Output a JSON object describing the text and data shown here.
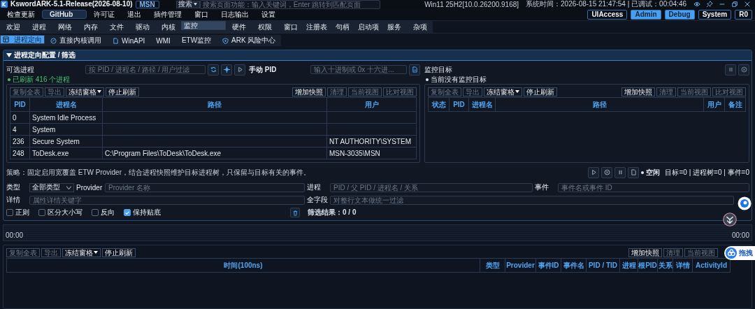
{
  "window": {
    "title": "KswordARK-5.1-Release(2026-08-10)",
    "user_badge": "MSN"
  },
  "search": {
    "scope": "搜索",
    "placeholder": "搜索页面功能：输入关键词，Enter 跳转到匹配页面"
  },
  "system_info": {
    "version": "Win11 25H2[10.0.26200.9168]",
    "clock": "系统时间：2026-08-15 21:47:54 | 已调试：00:04:46"
  },
  "menu": [
    {
      "label": "检查更新",
      "selected": false
    },
    {
      "label": "GitHub",
      "selected": true
    },
    {
      "label": "许可证",
      "selected": false
    },
    {
      "label": "退出",
      "selected": false
    },
    {
      "label": "插件管理",
      "selected": false
    },
    {
      "label": "窗口",
      "selected": false
    },
    {
      "label": "日志输出",
      "selected": false
    },
    {
      "label": "设置",
      "selected": false
    }
  ],
  "badges": [
    {
      "label": "UIAccess",
      "on": false
    },
    {
      "label": "Admin",
      "on": true
    },
    {
      "label": "Debug",
      "on": true
    },
    {
      "label": "System",
      "on": false
    },
    {
      "label": "R0",
      "on": false
    }
  ],
  "tabs": [
    {
      "label": "欢迎",
      "selected": false
    },
    {
      "label": "进程",
      "selected": false
    },
    {
      "label": "网络",
      "selected": false
    },
    {
      "label": "内存",
      "selected": false
    },
    {
      "label": "文件",
      "selected": false
    },
    {
      "label": "驱动",
      "selected": false
    },
    {
      "label": "内核",
      "selected": false
    },
    {
      "label": "监控",
      "selected": true
    },
    {
      "label": "硬件",
      "selected": false
    },
    {
      "label": "权限",
      "selected": false
    },
    {
      "label": "窗口",
      "selected": false
    },
    {
      "label": "注册表",
      "selected": false
    },
    {
      "label": "句柄",
      "selected": false
    },
    {
      "label": "启动项",
      "selected": false
    },
    {
      "label": "服务",
      "selected": false
    },
    {
      "label": "杂项",
      "selected": false
    }
  ],
  "subtabs": [
    {
      "label": "进程定向",
      "selected": true
    },
    {
      "label": "直接内核调用",
      "selected": false
    },
    {
      "label": "WinAPI",
      "selected": false
    },
    {
      "label": "WMI",
      "selected": false
    },
    {
      "label": "ETW监控",
      "selected": false
    },
    {
      "label": "ARK 风险中心",
      "selected": false
    }
  ],
  "panel": {
    "title": "进程定向配置 / 筛选",
    "expanded": true,
    "picker": {
      "label": "可选进程",
      "filter_placeholder": "按 PID / 进程名 / 路径 / 用户过滤",
      "manual_label": "手动 PID",
      "manual_placeholder": "输入十进制或 0x 十六进...",
      "status": "已刷新 416 个进程",
      "table": {
        "toolbar_left": [
          {
            "label": "复制全表",
            "disabled": true,
            "dropdown": false
          },
          {
            "label": "导出",
            "disabled": true,
            "dropdown": false
          },
          {
            "label": "冻结窗格",
            "disabled": false,
            "dropdown": true
          },
          {
            "label": "停止刷新",
            "disabled": false,
            "dropdown": false
          }
        ],
        "toolbar_right": [
          {
            "label": "增加快照",
            "disabled": false,
            "dropdown": false
          },
          {
            "label": "清理",
            "disabled": true,
            "dropdown": false
          },
          {
            "label": "当前视图",
            "disabled": true,
            "dropdown": false
          },
          {
            "label": "比对视图",
            "disabled": true,
            "dropdown": false
          }
        ],
        "columns": [
          "PID",
          "进程名",
          "路径",
          "用户"
        ],
        "rows": [
          {
            "pid": "0",
            "name": "System Idle Process"
          },
          {
            "pid": "4",
            "name": "System"
          },
          {
            "pid": "236",
            "name": "Secure System",
            "user": "NT AUTHORITY\\SYSTEM"
          },
          {
            "pid": "248",
            "name": "ToDesk.exe",
            "path": "C:\\Program Files\\ToDesk\\ToDesk.exe",
            "user": "MSN-3035\\MSN"
          }
        ]
      }
    },
    "targets": {
      "label": "监控目标",
      "status": "当前没有监控目标",
      "table": {
        "toolbar_left": [
          {
            "label": "复制全表",
            "disabled": true,
            "dropdown": false
          },
          {
            "label": "导出",
            "disabled": true,
            "dropdown": false
          },
          {
            "label": "冻结窗格",
            "disabled": false,
            "dropdown": true
          },
          {
            "label": "停止刷新",
            "disabled": false,
            "dropdown": false
          }
        ],
        "toolbar_right": [
          {
            "label": "增加快照",
            "disabled": false,
            "dropdown": false
          },
          {
            "label": "清理",
            "disabled": true,
            "dropdown": false
          },
          {
            "label": "当前视图",
            "disabled": true,
            "dropdown": false
          },
          {
            "label": "比对视图",
            "disabled": true,
            "dropdown": false
          }
        ],
        "columns": [
          "状态",
          "PID",
          "进程名",
          "路径",
          "用户",
          "备注"
        ]
      }
    },
    "strategy": "策略：固定启用宽覆盖 ETW Provider，结合进程快照维护目标进程树，只保留与目标有关的事件。",
    "run_state": "空闲",
    "counters": "目标=0 | 进程树=0 | 事件=0",
    "filters": {
      "type_label": "类型",
      "type_value": "全部类型",
      "provider_label": "Provider",
      "provider_placeholder": "Provider 名称",
      "process_label": "进程",
      "process_placeholder": "PID / 父 PID / 进程名 / 关系",
      "event_label": "事件",
      "event_placeholder": "事件名或事件 ID",
      "detail_label": "详情",
      "detail_placeholder": "属性详情关键字",
      "all_label": "全字段",
      "all_placeholder": "对整行文本做统一过滤"
    },
    "options": [
      {
        "label": "正则",
        "checked": false
      },
      {
        "label": "区分大小写",
        "checked": false
      },
      {
        "label": "反向",
        "checked": false
      },
      {
        "label": "保持贴底",
        "checked": true
      }
    ],
    "result": "筛选结果：0 / 0"
  },
  "timeline": {
    "start": "00:00",
    "end": "00:00"
  },
  "events": {
    "table": {
      "toolbar_left": [
        {
          "label": "复制全表",
          "disabled": true,
          "dropdown": false
        },
        {
          "label": "导出",
          "disabled": true,
          "dropdown": false
        },
        {
          "label": "冻结窗格",
          "disabled": false,
          "dropdown": true
        },
        {
          "label": "停止刷新",
          "disabled": false,
          "dropdown": false
        }
      ],
      "toolbar_right": [
        {
          "label": "增加快照",
          "disabled": false,
          "dropdown": false
        },
        {
          "label": "清理",
          "disabled": true,
          "dropdown": false
        },
        {
          "label": "当前视图",
          "disabled": true,
          "dropdown": false
        }
      ],
      "columns": [
        "时间(100ns)",
        "类型",
        "Provider",
        "事件ID",
        "事件名",
        "PID / TID",
        "进程",
        "根PID",
        "关系",
        "详情",
        "ActivityId"
      ]
    }
  },
  "drag_button": "拖拽"
}
